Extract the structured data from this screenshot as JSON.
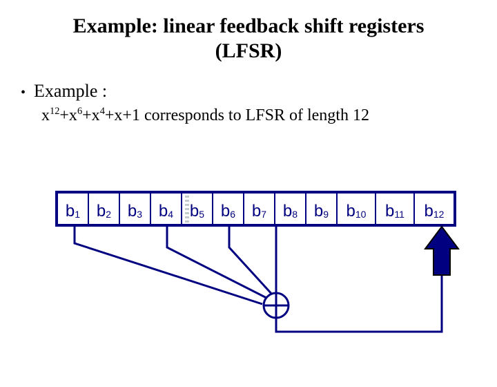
{
  "title_line1": "Example: linear feedback shift registers",
  "title_line2": "(LFSR)",
  "bullet": "Example :",
  "polynomial_plain": "x^12+x^6+x^4+x+1 corresponds to LFSR of length 12",
  "register_labels": [
    "b1",
    "b2",
    "b3",
    "b4",
    "b5",
    "b6",
    "b7",
    "b8",
    "b9",
    "b10",
    "b11",
    "b12"
  ],
  "lfsr": {
    "length": 12,
    "polynomial_exponents": [
      12,
      6,
      4,
      1,
      0
    ],
    "tap_positions": [
      1,
      4,
      6,
      12
    ]
  }
}
